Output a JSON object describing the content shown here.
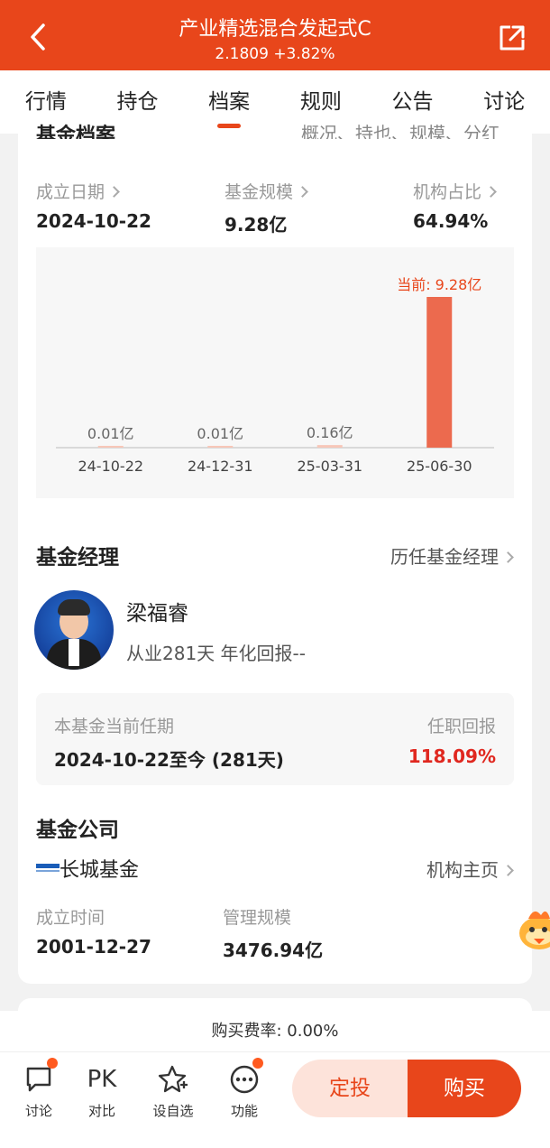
{
  "header": {
    "title": "产业精选混合发起式C",
    "price": "2.1809",
    "change": "+3.82%",
    "back_icon": "back-arrow-icon",
    "share_icon": "share-icon"
  },
  "tabs": [
    "行情",
    "持仓",
    "档案",
    "规则",
    "公告",
    "讨论"
  ],
  "active_tab": "档案",
  "archive": {
    "cut_title": "基金档案",
    "cut_right": "概况、持也、规模、分红",
    "stats": [
      {
        "label": "成立日期",
        "value": "2024-10-22"
      },
      {
        "label": "基金规模",
        "value": "9.28亿"
      },
      {
        "label": "机构占比",
        "value": "64.94%"
      }
    ]
  },
  "chart_data": {
    "type": "bar",
    "categories": [
      "24-10-22",
      "24-12-31",
      "25-03-31",
      "25-06-30"
    ],
    "values": [
      0.01,
      0.01,
      0.16,
      9.28
    ],
    "data_labels": [
      "0.01亿",
      "0.01亿",
      "0.16亿",
      "当前: 9.28亿"
    ],
    "unit": "亿",
    "ylim": [
      0,
      9.28
    ],
    "highlight_color": "#ec6a4e",
    "bar_color": "#f7c7b8"
  },
  "manager": {
    "section_title": "基金经理",
    "history_link": "历任基金经理",
    "name": "梁福睿",
    "summary": "从业281天 年化回报--",
    "tenure_label": "本基金当前任期",
    "tenure_value": "2024-10-22至今 (281天)",
    "return_label": "任职回报",
    "return_value": "118.09%",
    "return_color": "#e0271f"
  },
  "company": {
    "section_title": "基金公司",
    "name": "长城基金",
    "homepage_link": "机构主页",
    "founded_label": "成立时间",
    "founded_value": "2001-12-27",
    "aum_label": "管理规模",
    "aum_value": "3476.94亿"
  },
  "fee": {
    "text": "购买费率: 0.00%"
  },
  "bottom_bar": {
    "items": [
      {
        "label": "讨论",
        "icon": "chat-icon",
        "badge": true
      },
      {
        "label": "对比",
        "icon": "pk-icon",
        "text": "PK",
        "badge": false
      },
      {
        "label": "设自选",
        "icon": "star-add-icon",
        "badge": false
      },
      {
        "label": "功能",
        "icon": "more-icon",
        "badge": true
      }
    ],
    "sip_button": "定投",
    "buy_button": "购买"
  },
  "colors": {
    "brand": "#e8461b"
  }
}
